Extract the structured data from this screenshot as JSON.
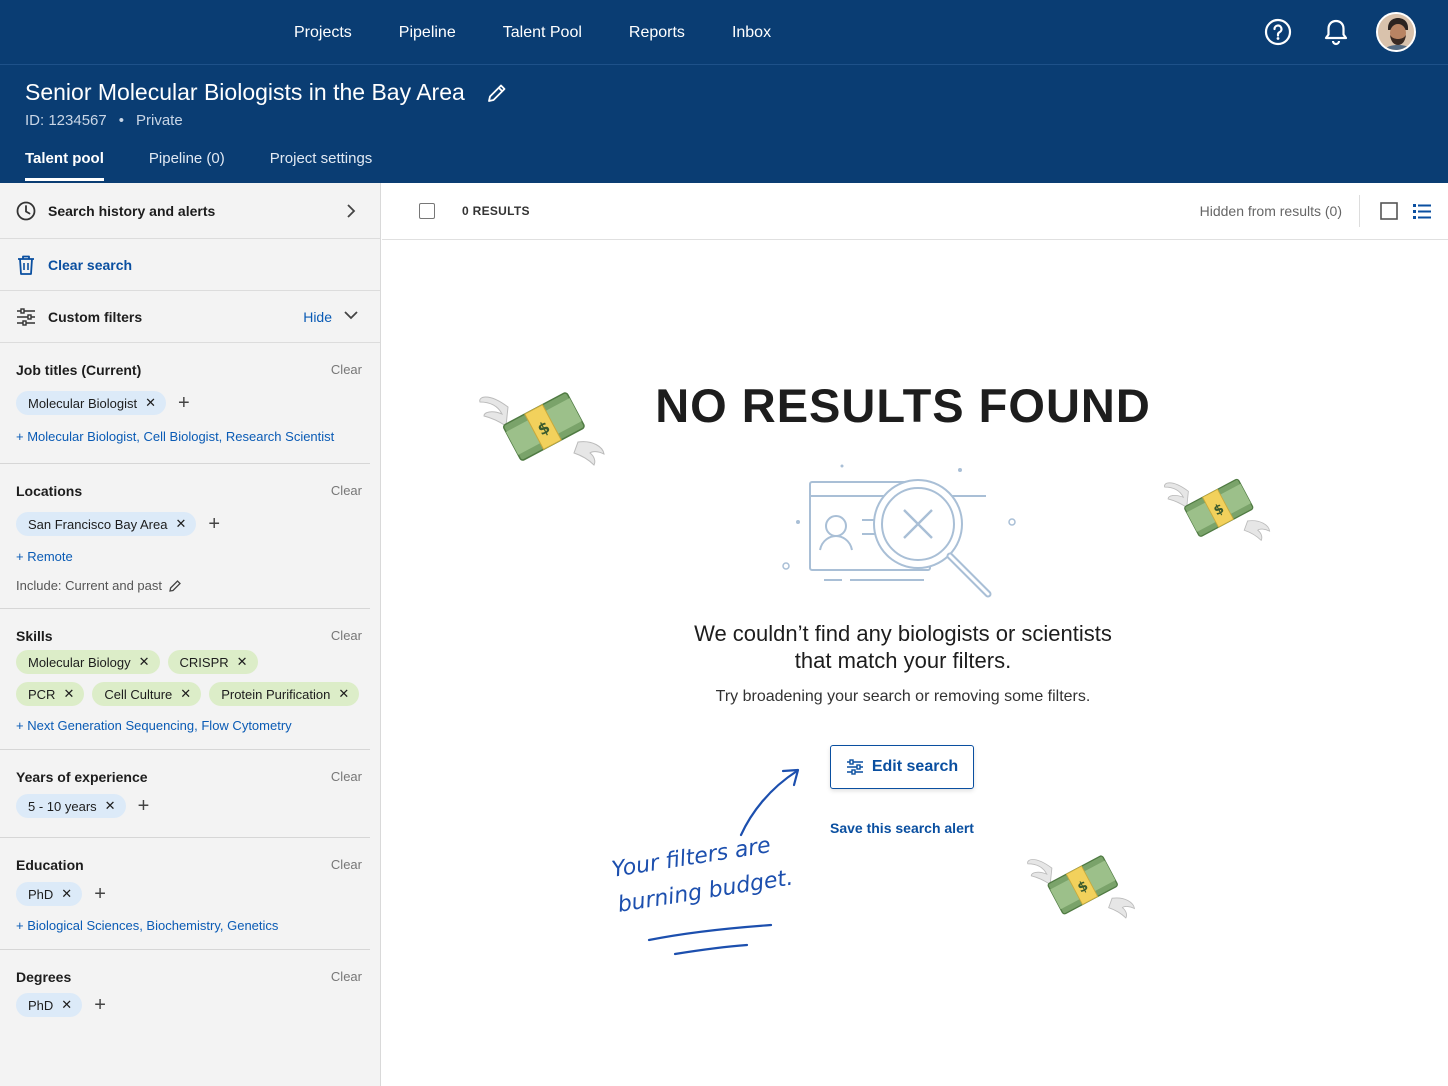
{
  "topnav": {
    "links": [
      "Projects",
      "Pipeline",
      "Talent Pool",
      "Reports",
      "Inbox"
    ]
  },
  "project": {
    "title": "Senior Molecular Biologists in the Bay Area",
    "id": "ID: 1234567",
    "visibility": "Private",
    "tabs": [
      {
        "label": "Talent pool",
        "active": true
      },
      {
        "label": "Pipeline (0)",
        "active": false
      },
      {
        "label": "Project settings",
        "active": false
      }
    ]
  },
  "sidebar": {
    "history": "Search history and alerts",
    "clear_search": "Clear search",
    "custom_filters": "Custom filters",
    "hide": "Hide",
    "sections": {
      "job_titles": {
        "heading": "Job titles (Current)",
        "clear": "Clear",
        "chips": [
          "Molecular Biologist"
        ],
        "suggest": "+ Molecular Biologist, Cell Biologist, Research Scientist"
      },
      "locations": {
        "heading": "Locations",
        "clear": "Clear",
        "chips": [
          "San Francisco Bay Area"
        ],
        "suggest": "+ Remote",
        "include": "Include: Current and past"
      },
      "skills": {
        "heading": "Skills",
        "clear": "Clear",
        "chips": [
          "Molecular Biology",
          "CRISPR",
          "PCR",
          "Cell Culture",
          "Protein Purification"
        ],
        "suggest": "+ Next Generation Sequencing, Flow Cytometry"
      },
      "years": {
        "heading": "Years of experience",
        "clear": "Clear",
        "chips": [
          "5 - 10 years"
        ]
      },
      "education": {
        "heading": "Education",
        "clear": "Clear",
        "chips": [
          "PhD"
        ],
        "suggest": "+ Biological Sciences, Biochemistry, Genetics"
      },
      "degrees": {
        "heading": "Degrees",
        "clear": "Clear",
        "chips": [
          "PhD"
        ]
      }
    }
  },
  "results": {
    "count": "0 RESULTS",
    "hidden": "Hidden from results (0)"
  },
  "empty": {
    "title": "NO RESULTS FOUND",
    "message_line1": "We couldn’t find any biologists or scientists",
    "message_line2": "that match your filters.",
    "sub": "Try broadening your search or removing some filters.",
    "edit_button": "Edit search",
    "save_alert": "Save this search alert",
    "note_line1": "Your filters are",
    "note_line2": "burning budget."
  },
  "colors": {
    "brand": "#0a3d73",
    "link": "#0a4fa0",
    "chip_blue": "#dceaf8",
    "chip_green": "#dcedc8",
    "note_ink": "#1c4fae"
  },
  "icons": {
    "help": "help-circle-icon",
    "bell": "bell-icon",
    "edit": "pencil-icon",
    "history": "clock-icon",
    "clear": "trash-icon",
    "filters": "sliders-icon",
    "money": "money-with-wings-icon"
  }
}
